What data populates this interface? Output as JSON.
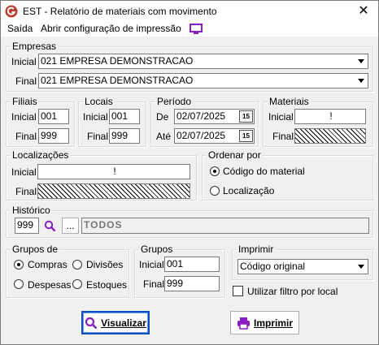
{
  "window": {
    "title": "EST -  Relatório de materiais com movimento",
    "close_label": "✕"
  },
  "menu": {
    "items": [
      "Saída",
      "Abrir configuração de impressão"
    ]
  },
  "empresas": {
    "legend": "Empresas",
    "inicial_label": "Inicial",
    "inicial_value": "021 EMPRESA DEMONSTRACAO",
    "final_label": "Final",
    "final_value": "021 EMPRESA DEMONSTRACAO"
  },
  "filiais": {
    "legend": "Filiais",
    "inicial_label": "Inicial",
    "inicial_value": "001",
    "final_label": "Final",
    "final_value": "999"
  },
  "locais": {
    "legend": "Locais",
    "inicial_label": "Inicial",
    "inicial_value": "001",
    "final_label": "Final",
    "final_value": "999"
  },
  "periodo": {
    "legend": "Período",
    "de_label": "De",
    "de_value": "02/07/2025",
    "ate_label": "Até",
    "ate_value": "02/07/2025",
    "cal_label": "15"
  },
  "materiais": {
    "legend": "Materiais",
    "inicial_label": "Inicial",
    "inicial_value": "!",
    "final_label": "Final"
  },
  "localizacoes": {
    "legend": "Localizações",
    "inicial_label": "Inicial",
    "inicial_value": "!",
    "final_label": "Final"
  },
  "ordenar": {
    "legend": "Ordenar por",
    "options": [
      "Código do material",
      "Localização"
    ],
    "selected": 0
  },
  "historico": {
    "legend": "Histórico",
    "code": "999",
    "more_label": "...",
    "description": "TODOS"
  },
  "grupos_de": {
    "legend": "Grupos de",
    "options": [
      "Compras",
      "Divisões",
      "Despesas",
      "Estoques"
    ],
    "selected": 0
  },
  "grupos": {
    "legend": "Grupos",
    "inicial_label": "Inicial",
    "inicial_value": "001",
    "final_label": "Final",
    "final_value": "999"
  },
  "imprimir": {
    "legend": "Imprimir",
    "selected_option": "Código original",
    "filter_label": "Utilizar filtro por local",
    "filter_checked": false
  },
  "buttons": {
    "visualizar": "Visualizar",
    "imprimir": "Imprimir"
  },
  "colors": {
    "accent": "#0b4fc2",
    "icon_purple": "#8a1ec4",
    "app_red": "#c0392b"
  }
}
